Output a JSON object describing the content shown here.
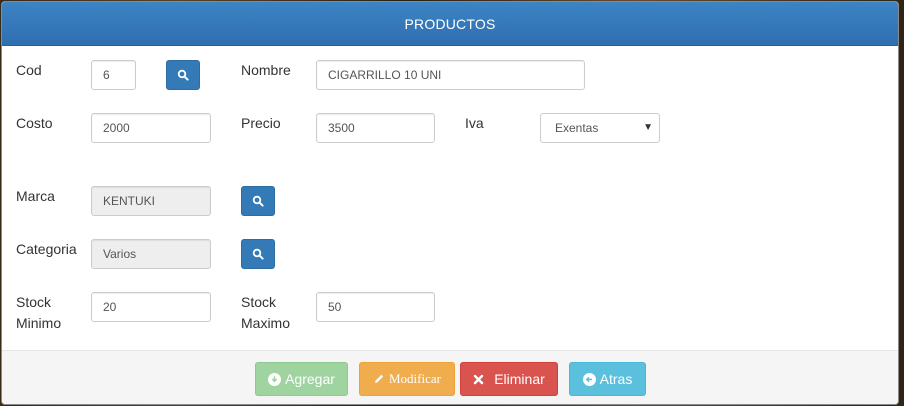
{
  "modal": {
    "title": "PRODUCTOS"
  },
  "form": {
    "cod": {
      "label": "Cod",
      "value": "6"
    },
    "nombre": {
      "label": "Nombre",
      "value": "CIGARRILLO 10 UNI"
    },
    "costo": {
      "label": "Costo",
      "value": "2000"
    },
    "precio": {
      "label": "Precio",
      "value": "3500"
    },
    "iva": {
      "label": "Iva",
      "selected": "Exentas"
    },
    "marca": {
      "label": "Marca",
      "value": "KENTUKI"
    },
    "categoria": {
      "label": "Categoria",
      "value": "Varios"
    },
    "stock_minimo": {
      "label_line1": "Stock",
      "label_line2": "Minimo",
      "value": "20"
    },
    "stock_maximo": {
      "label_line1": "Stock",
      "label_line2": "Maximo",
      "value": "50"
    }
  },
  "footer": {
    "agregar": "Agregar",
    "modificar": "Modificar",
    "eliminar": "Eliminar",
    "atras": "Atras"
  },
  "colors": {
    "header": "#337ab7",
    "primary": "#337ab7",
    "success": "#9fd3a0",
    "warning": "#f0ad4e",
    "danger": "#d9534f",
    "info": "#5bc0de"
  },
  "icons": {
    "search": "search-icon",
    "agregar": "download-circle-icon",
    "modificar": "pencil-icon",
    "eliminar": "close-icon",
    "atras": "arrow-left-circle-icon"
  }
}
